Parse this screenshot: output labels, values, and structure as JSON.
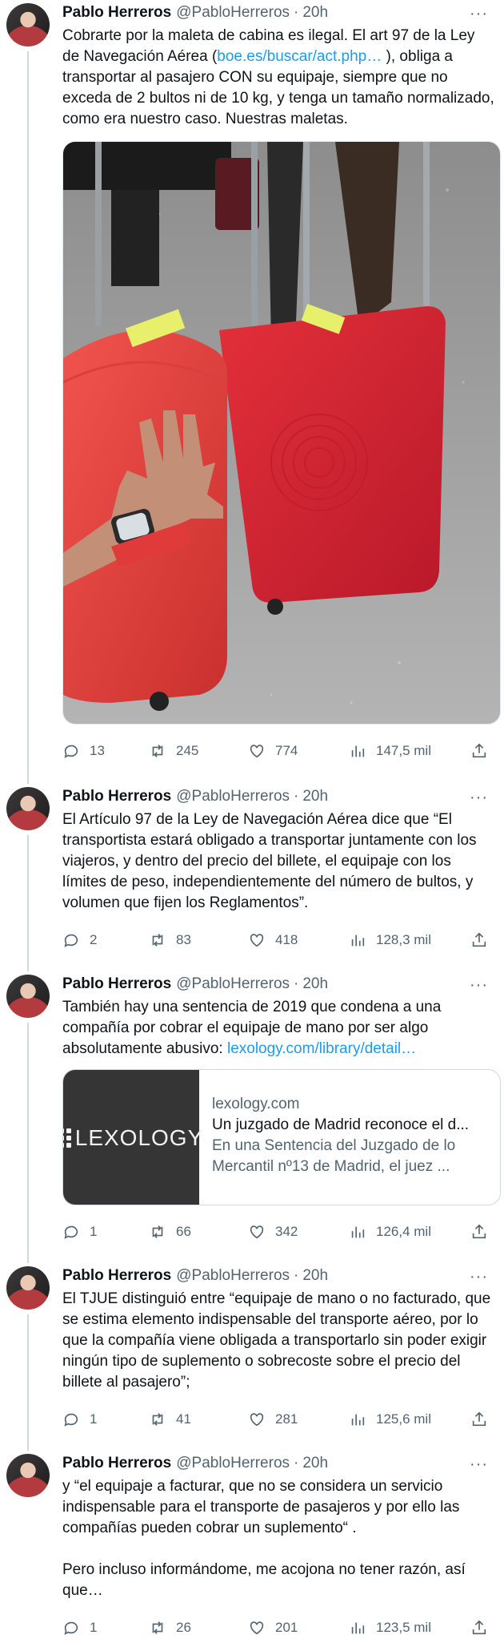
{
  "user": {
    "name": "Pablo Herreros",
    "handle": "@PabloHerreros",
    "time": "20h",
    "separator": "·"
  },
  "tweets": [
    {
      "text_parts": [
        "Cobrarte por la maleta de cabina es ilegal. El art 97 de la Ley de Navegación Aérea (",
        "boe.es/buscar/act.php…",
        " ), obliga a transportar al pasajero CON su equipaje, siempre que no exceda de 2 bultos ni de 10 kg, y tenga un tamaño normalizado, como era nuestro caso. Nuestras maletas."
      ],
      "stats": {
        "replies": "13",
        "retweets": "245",
        "likes": "774",
        "views": "147,5 mil"
      }
    },
    {
      "text": "El Artículo 97 de la Ley de Navegación Aérea dice que “El transportista estará obligado a transportar juntamente con los viajeros, y dentro del precio del billete, el equipaje con los límites de peso, independientemente del número de bultos, y volumen que fijen los Reglamentos”.",
      "stats": {
        "replies": "2",
        "retweets": "83",
        "likes": "418",
        "views": "128,3 mil"
      }
    },
    {
      "text_parts": [
        "También hay una sentencia de 2019 que condena a una compañía por cobrar el equipaje de mano por ser algo absolutamente abusivo: ",
        "lexology.com/library/detail…"
      ],
      "card": {
        "logo": "LEXOLOGY",
        "domain": "lexology.com",
        "title": "Un juzgado de Madrid reconoce el d...",
        "description": "En una Sentencia del Juzgado de lo Mercantil nº13 de Madrid, el juez ..."
      },
      "stats": {
        "replies": "1",
        "retweets": "66",
        "likes": "342",
        "views": "126,4 mil"
      }
    },
    {
      "text": "El TJUE distinguió entre “equipaje de mano o no facturado, que se estima elemento indispensable del transporte aéreo, por lo que la compañía viene obligada a transportarlo sin poder exigir ningún tipo de suplemento o sobrecoste sobre el precio del billete al pasajero”;",
      "stats": {
        "replies": "1",
        "retweets": "41",
        "likes": "281",
        "views": "125,6 mil"
      }
    },
    {
      "text_p1": "y “el equipaje a facturar, que no se considera un servicio indispensable para el transporte de pasajeros y por ello las compañías pueden cobrar un suplemento“ .",
      "text_p2": "Pero incluso informándome, me acojona no tener razón, así que…",
      "stats": {
        "replies": "1",
        "retweets": "26",
        "likes": "201",
        "views": "123,5 mil"
      }
    }
  ],
  "more_label": "···",
  "colors": {
    "link": "#1d9bf0",
    "muted": "#536471",
    "text": "#0f1419",
    "connector": "#cfd9de"
  }
}
